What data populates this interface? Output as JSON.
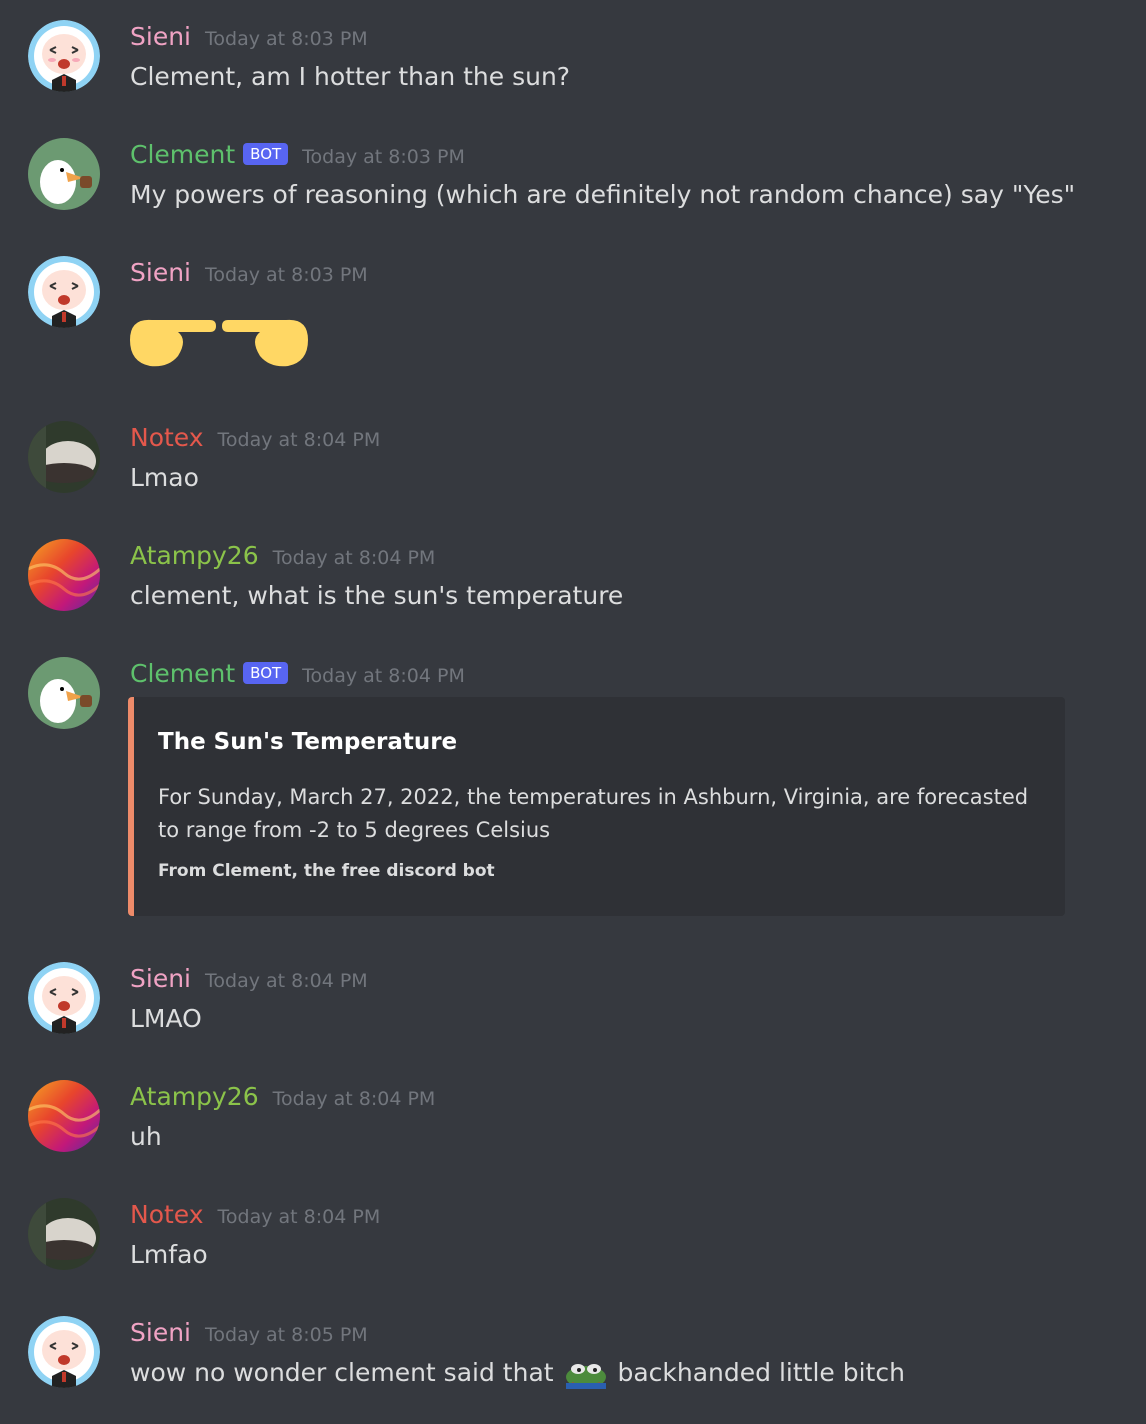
{
  "colors": {
    "background": "#36393f",
    "sieni": "#f0a3c4",
    "clement": "#5ec16c",
    "notex": "#e4584c",
    "atampy": "#8bc34a",
    "bot_tag": "#5865f2",
    "embed_accent": "#ee8b6a",
    "timestamp": "#72767d"
  },
  "bot_tag_label": "BOT",
  "messages": [
    {
      "author": "Sieni",
      "timestamp": "Today at 8:03 PM",
      "text": "Clement, am I hotter than the sun?"
    },
    {
      "author": "Clement",
      "timestamp": "Today at 8:03 PM",
      "text": "My powers of reasoning (which are definitely not random chance) say \"Yes\""
    },
    {
      "author": "Sieni",
      "timestamp": "Today at 8:03 PM",
      "emoji": "pointing-fingers-together"
    },
    {
      "author": "Notex",
      "timestamp": "Today at 8:04 PM",
      "text": "Lmao"
    },
    {
      "author": "Atampy26",
      "timestamp": "Today at 8:04 PM",
      "text": "clement, what is the sun's temperature"
    },
    {
      "author": "Clement",
      "timestamp": "Today at 8:04 PM",
      "embed": {
        "title": "The Sun's Temperature",
        "description": "For Sunday, March 27, 2022, the temperatures in Ashburn, Virginia, are forecasted to range from -2 to 5 degrees Celsius",
        "footer": "From Clement, the free discord bot"
      }
    },
    {
      "author": "Sieni",
      "timestamp": "Today at 8:04 PM",
      "text": "LMAO"
    },
    {
      "author": "Atampy26",
      "timestamp": "Today at 8:04 PM",
      "text": "uh"
    },
    {
      "author": "Notex",
      "timestamp": "Today at 8:04 PM",
      "text": "Lmfao"
    },
    {
      "author": "Sieni",
      "timestamp": "Today at 8:05 PM",
      "text_before": "wow no wonder clement said that",
      "inline_emoji": "pepe-frog",
      "text_after": "backhanded little bitch"
    }
  ]
}
